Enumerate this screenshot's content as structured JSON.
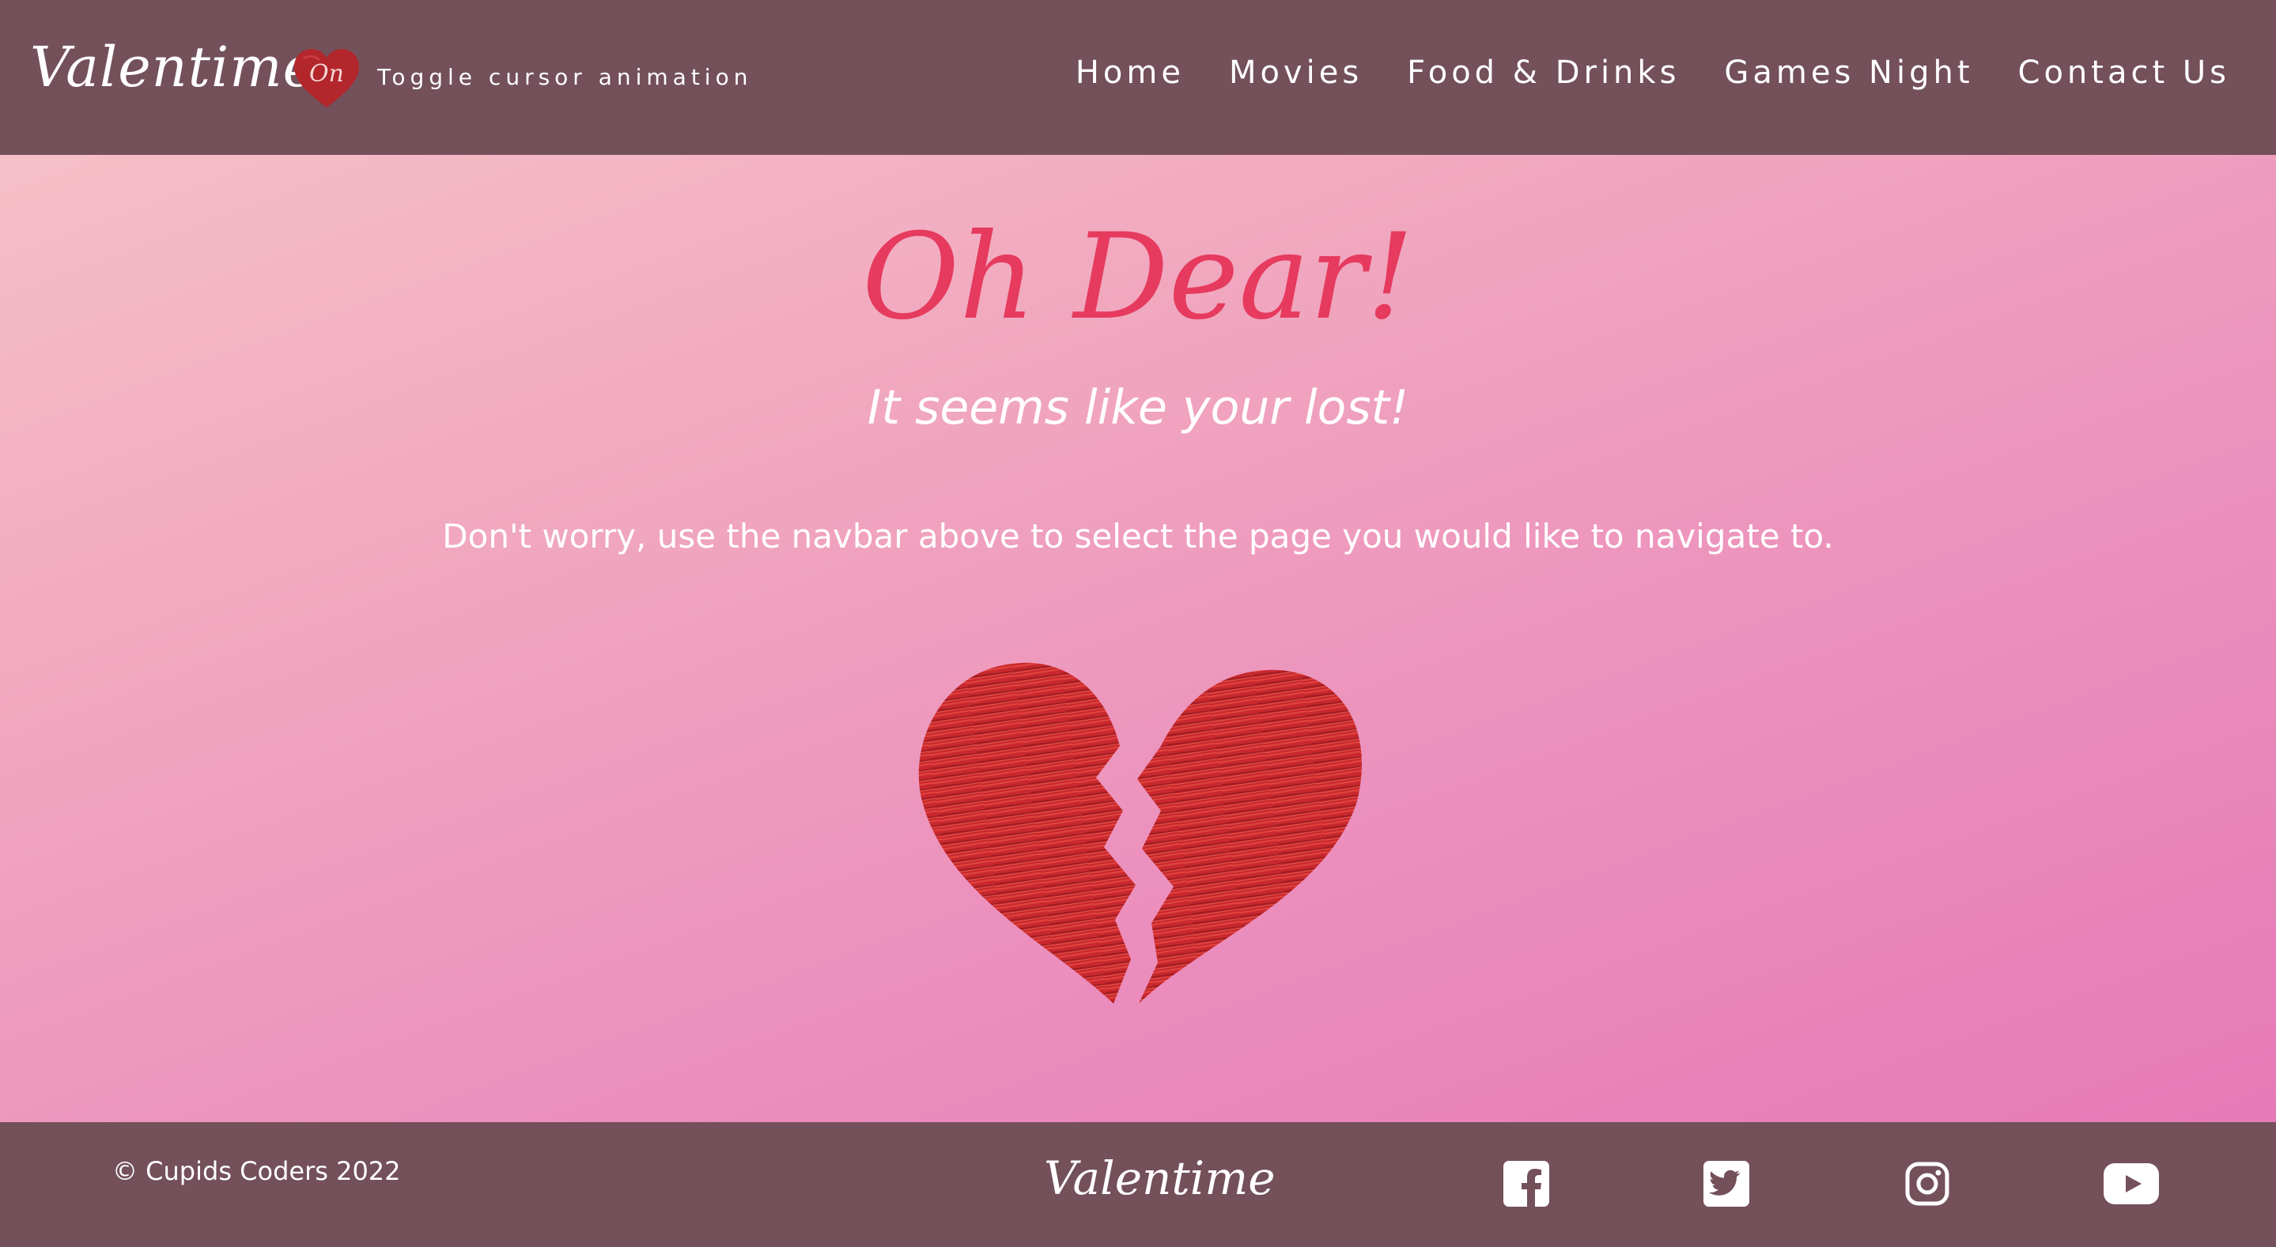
{
  "navbar": {
    "brand": "Valentime",
    "toggle_state": "On",
    "toggle_label": "Toggle cursor animation",
    "links": [
      "Home",
      "Movies",
      "Food & Drinks",
      "Games Night",
      "Contact Us"
    ]
  },
  "main": {
    "headline": "Oh Dear!",
    "subheadline": "It seems like your lost!",
    "message": "Don't worry, use the navbar above to select the page you would like to navigate to.",
    "illustration_icon": "broken-heart-icon"
  },
  "footer": {
    "copyright": "© Cupids Coders 2022",
    "brand": "Valentime",
    "social_icons": [
      "facebook-icon",
      "twitter-icon",
      "instagram-icon",
      "youtube-icon"
    ]
  },
  "colors": {
    "nav_background": "#73505a",
    "headline": "#e63a5e",
    "heart_red": "#c8282e",
    "gradient_start": "#f6bfc8",
    "gradient_end": "#e57ab8"
  }
}
